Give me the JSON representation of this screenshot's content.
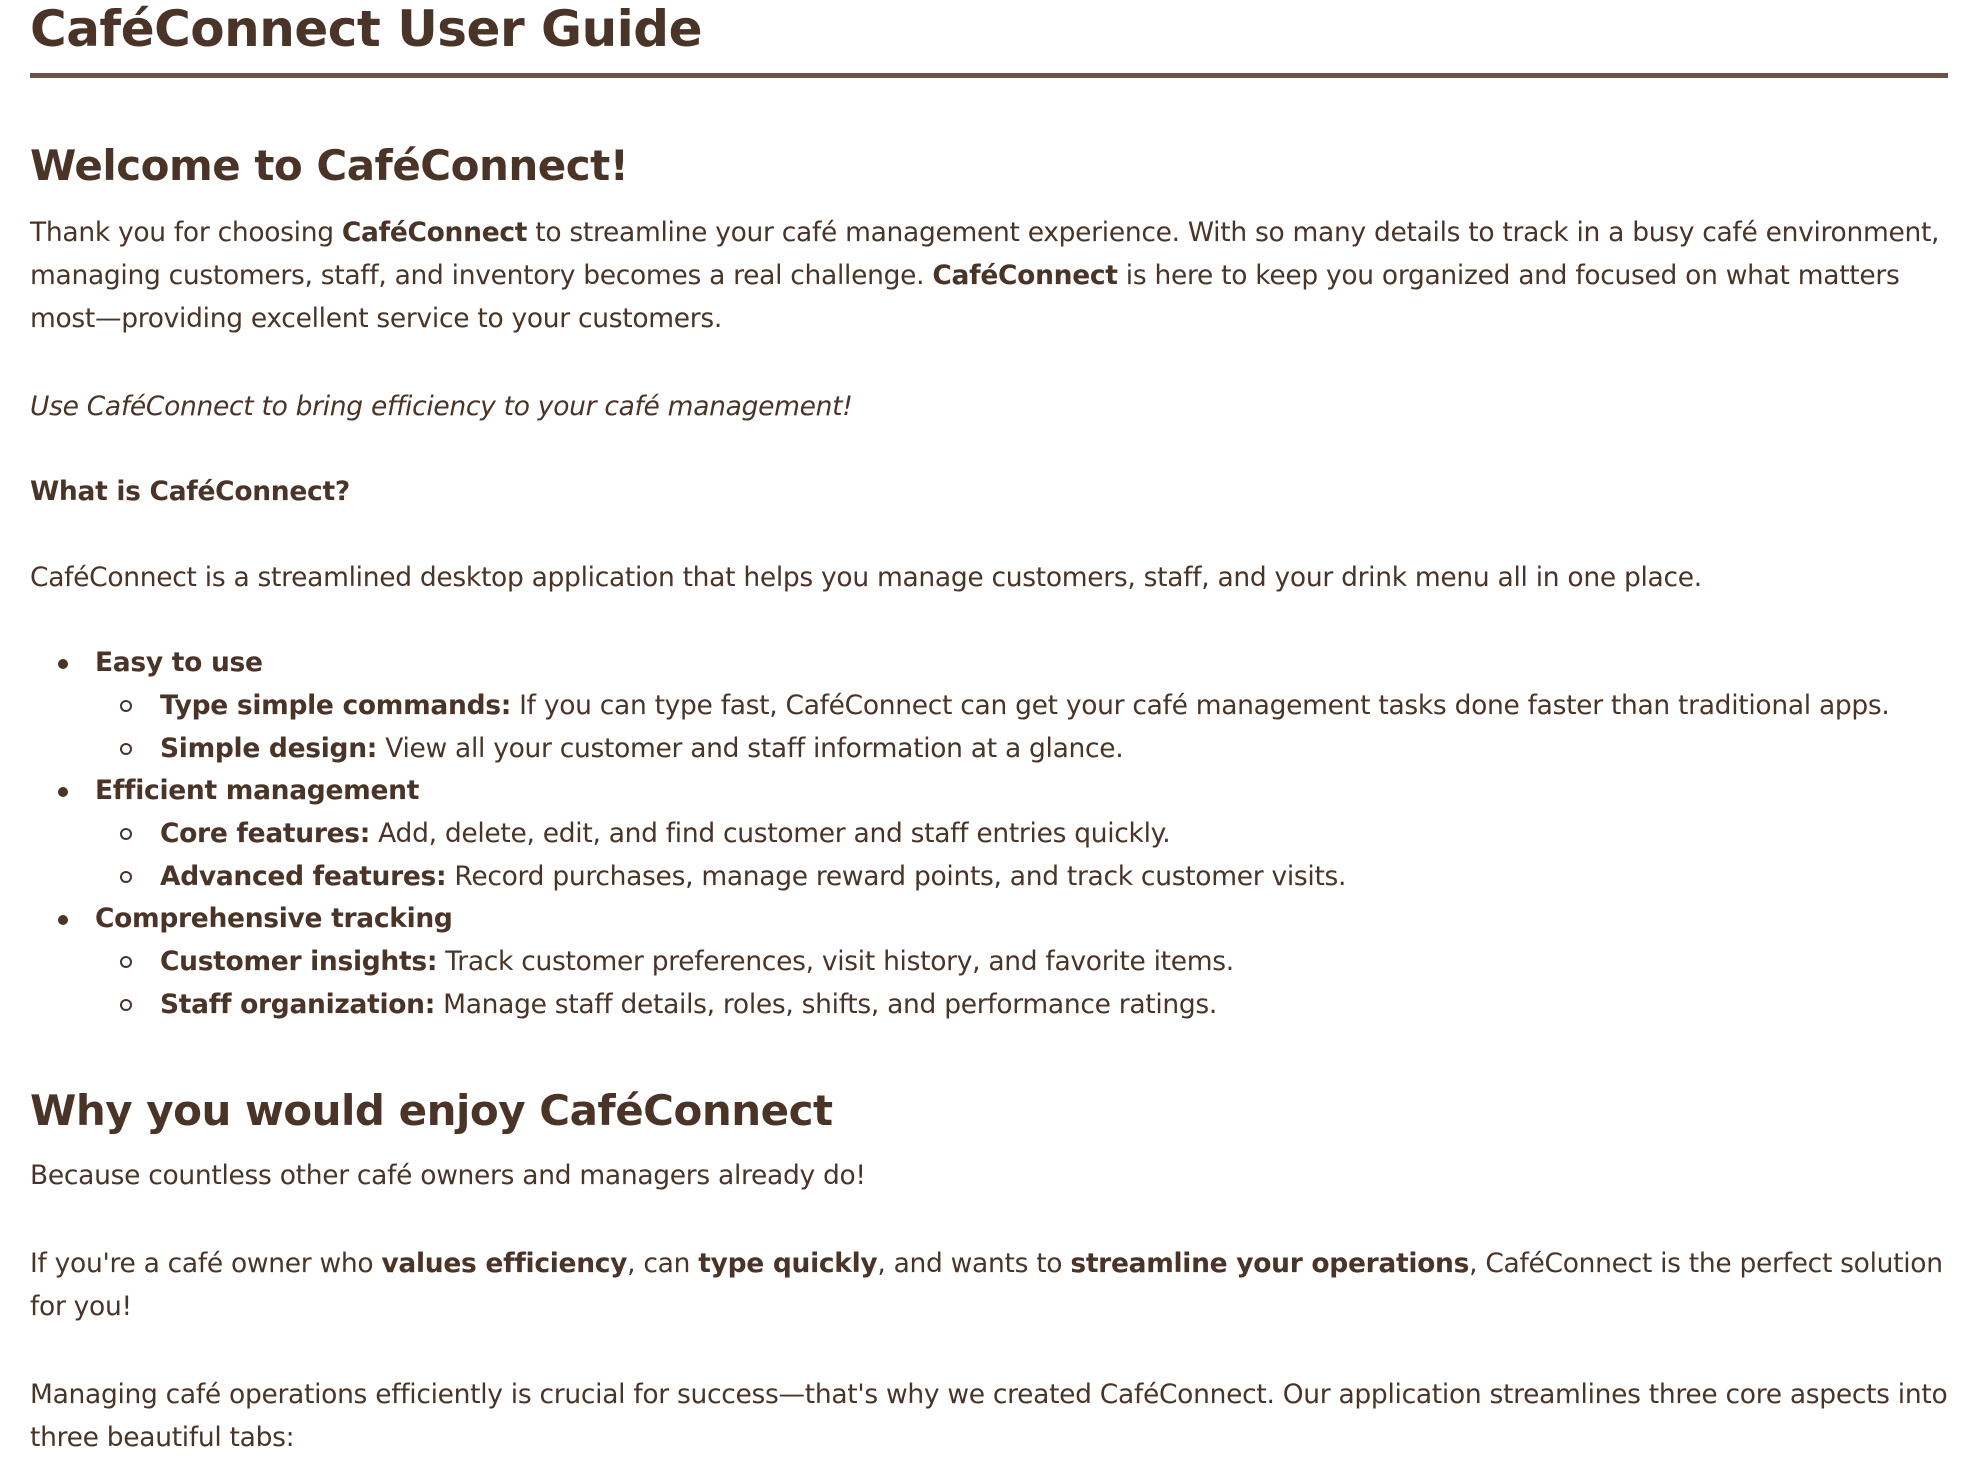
{
  "document": {
    "title": "CaféConnect User Guide"
  },
  "welcome": {
    "heading": "Welcome to CaféConnect!",
    "intro": {
      "t1": "Thank you for choosing ",
      "b1": "CaféConnect",
      "t2": " to streamline your café management experience. With so many details to track in a busy café environment, managing customers, staff, and inventory becomes a real challenge. ",
      "b2": "CaféConnect",
      "t3": " is here to keep you organized and focused on what matters most—providing excellent service to your customers."
    },
    "tagline": "Use CaféConnect to bring efficiency to your café management!",
    "what_is_heading": "What is CaféConnect?",
    "what_is_text": "CaféConnect is a streamlined desktop application that helps you manage customers, staff, and your drink menu all in one place.",
    "features": [
      {
        "label": "Easy to use",
        "items": [
          {
            "term": "Type simple commands:",
            "desc": " If you can type fast, CaféConnect can get your café management tasks done faster than traditional apps."
          },
          {
            "term": "Simple design:",
            "desc": " View all your customer and staff information at a glance."
          }
        ]
      },
      {
        "label": "Efficient management",
        "items": [
          {
            "term": "Core features:",
            "desc": " Add, delete, edit, and find customer and staff entries quickly."
          },
          {
            "term": "Advanced features:",
            "desc": " Record purchases, manage reward points, and track customer visits."
          }
        ]
      },
      {
        "label": "Comprehensive tracking",
        "items": [
          {
            "term": "Customer insights:",
            "desc": " Track customer preferences, visit history, and favorite items."
          },
          {
            "term": "Staff organization:",
            "desc": " Manage staff details, roles, shifts, and performance ratings."
          }
        ]
      }
    ]
  },
  "why": {
    "heading": "Why you would enjoy CaféConnect",
    "p1": "Because countless other café owners and managers already do!",
    "p2": {
      "t1": "If you're a café owner who ",
      "b1": "values efficiency",
      "t2": ", can ",
      "b2": "type quickly",
      "t3": ", and wants to ",
      "b3": "streamline your operations",
      "t4": ", CaféConnect is the perfect solution for you!"
    },
    "p3": "Managing café operations efficiently is crucial for success—that's why we created CaféConnect. Our application streamlines three core aspects into three beautiful tabs:"
  }
}
